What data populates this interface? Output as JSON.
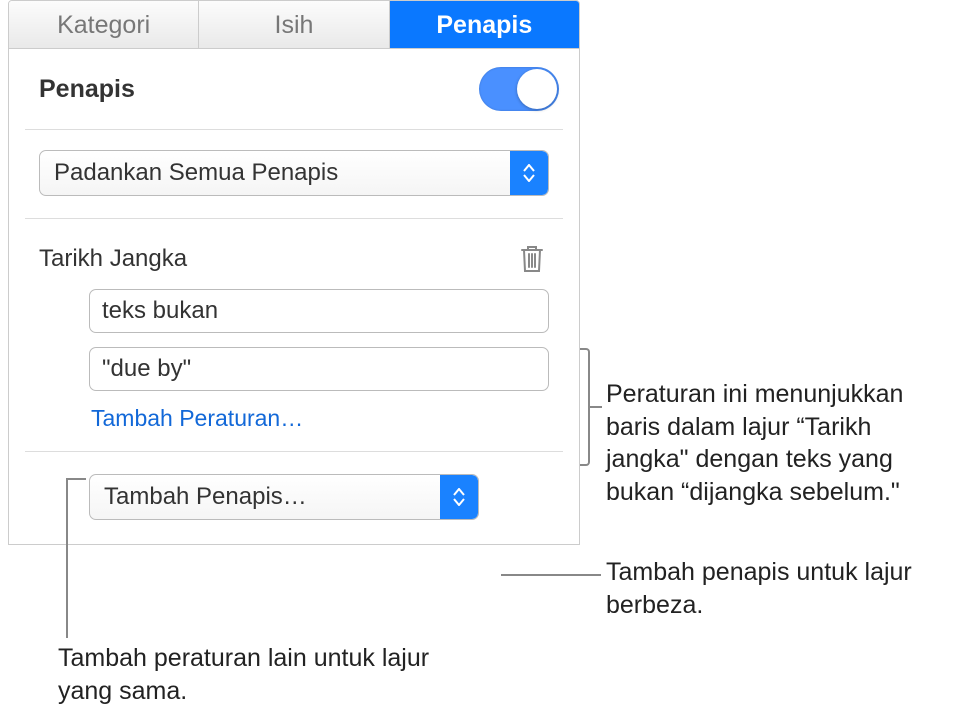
{
  "tabs": {
    "kategori": "Kategori",
    "isih": "Isih",
    "penapis": "Penapis"
  },
  "header": {
    "title": "Penapis"
  },
  "match_select": {
    "value": "Padankan Semua Penapis"
  },
  "rule": {
    "title": "Tarikh Jangka",
    "condition_value": "teks bukan",
    "text_value": "\"due by\"",
    "add_rule_label": "Tambah Peraturan…"
  },
  "add_filter": {
    "label": "Tambah Penapis…"
  },
  "annotations": {
    "rule_explain": "Peraturan ini menunjukkan baris dalam lajur “Tarikh jangka\" dengan teks yang bukan “dijangka sebelum.\"",
    "add_filter_explain": "Tambah penapis untuk lajur berbeza.",
    "add_rule_explain": "Tambah peraturan lain untuk lajur yang sama."
  }
}
